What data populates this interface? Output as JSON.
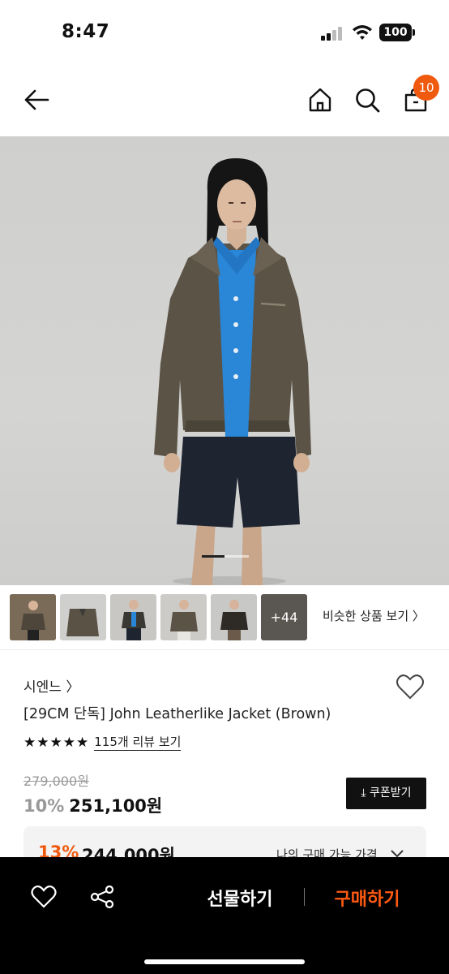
{
  "status_bar": {
    "time": "8:47",
    "battery": "100"
  },
  "nav": {
    "cart_count": "10"
  },
  "thumbnails": {
    "more_count": "+44",
    "similar_label": "비슷한 상품 보기 〉"
  },
  "product": {
    "brand": "시엔느 〉",
    "title": "[29CM 단독] John Leatherlike Jacket (Brown)",
    "rating_stars": 5,
    "review_link": "115개 리뷰 보기",
    "original_price": "279,000원",
    "discount": "10%",
    "price": "251,100원",
    "coupon_button": "⤓ 쿠폰받기"
  },
  "best_price": {
    "discount": "13%",
    "price": "244,000원",
    "label": "나의 구매 가능 가격"
  },
  "bottom_bar": {
    "gift_label": "선물하기",
    "buy_label": "구매하기"
  },
  "colors": {
    "accent": "#f05a0f",
    "buy": "#ff5a12",
    "jacket": "#5b5346",
    "shirt": "#2a86d6"
  }
}
